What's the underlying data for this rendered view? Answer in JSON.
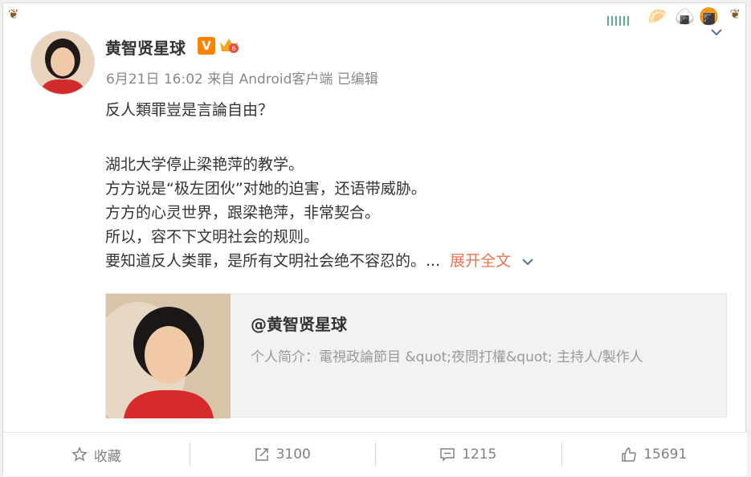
{
  "post": {
    "author": "黄智贤星球",
    "verified_badge": "V",
    "meta": "6月21日 16:02 来自 Android客户端   已编辑",
    "lines": [
      "反人類罪豈是言論自由？",
      "湖北大学停止梁艳萍的教学。",
      "方方说是“极左团伙”对她的迫害，还语带威胁。",
      "方方的心灵世界，跟梁艳萍，非常契合。",
      "所以，容不下文明社会的规则。",
      "要知道反人类罪，是所有文明社会绝不容忍的。..."
    ],
    "expand_label": "展开全文"
  },
  "link_card": {
    "title": "@黄智贤星球",
    "description": "个人简介：電視政論節目 &quot;夜問打權&quot; 主持人/製作人"
  },
  "actions": {
    "favorite": "收藏",
    "repost": "3100",
    "comment": "1215",
    "like": "15691"
  },
  "colors": {
    "accent": "#eb7350",
    "badge_orange": "#ff8200",
    "muted": "#888888"
  },
  "icons": [
    "star-icon",
    "repost-icon",
    "comment-icon",
    "thumbs-up-icon",
    "chevron-down-icon",
    "verified-v-icon",
    "crown-badge-icon"
  ]
}
